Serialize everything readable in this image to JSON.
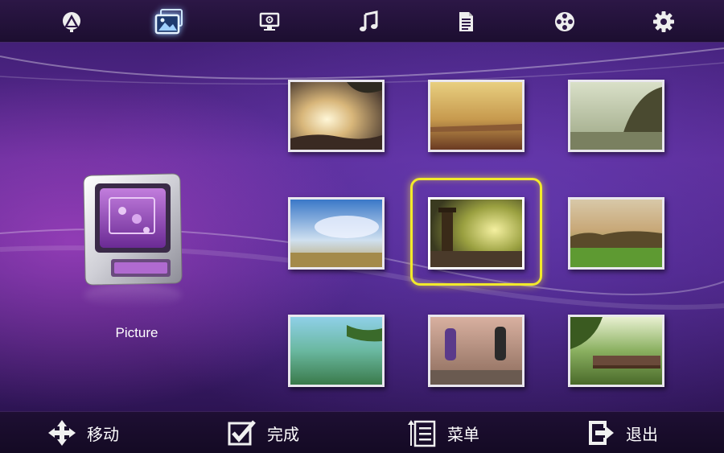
{
  "top_nav": [
    {
      "name": "home",
      "icon": "home-triangle-icon"
    },
    {
      "name": "picture",
      "icon": "picture-icon",
      "active": true
    },
    {
      "name": "video",
      "icon": "monitor-gear-icon"
    },
    {
      "name": "music",
      "icon": "music-note-icon"
    },
    {
      "name": "text",
      "icon": "document-icon"
    },
    {
      "name": "movie",
      "icon": "film-reel-icon"
    },
    {
      "name": "settings",
      "icon": "gear-icon"
    }
  ],
  "app": {
    "label": "Picture",
    "icon": "picture-app-icon"
  },
  "thumbnails": [
    {
      "scene": "sunburst-forest",
      "selected": false
    },
    {
      "scene": "golden-field",
      "selected": false
    },
    {
      "scene": "misty-tree-lake",
      "selected": false
    },
    {
      "scene": "blue-sky-meadow",
      "selected": false
    },
    {
      "scene": "lighthouse-sunset",
      "selected": true
    },
    {
      "scene": "green-field-treeline",
      "selected": false
    },
    {
      "scene": "tropical-lagoon",
      "selected": false
    },
    {
      "scene": "runners-road",
      "selected": false
    },
    {
      "scene": "park-bench",
      "selected": false
    }
  ],
  "footer": {
    "move_label": "移动",
    "done_label": "完成",
    "menu_label": "菜单",
    "exit_label": "退出"
  },
  "colors": {
    "selection": "#f2ea2a",
    "active_icon_glow": "#8fc4ff"
  }
}
